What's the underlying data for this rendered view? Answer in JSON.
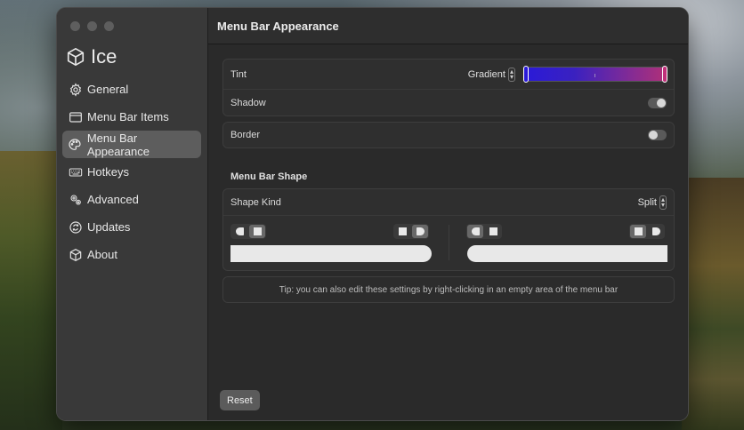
{
  "app": {
    "name": "Ice"
  },
  "sidebar": {
    "items": [
      {
        "label": "General",
        "icon": "gear-icon"
      },
      {
        "label": "Menu Bar Items",
        "icon": "menubar-icon"
      },
      {
        "label": "Menu Bar Appearance",
        "icon": "palette-icon",
        "active": true
      },
      {
        "label": "Hotkeys",
        "icon": "keyboard-icon"
      },
      {
        "label": "Advanced",
        "icon": "gears-icon"
      },
      {
        "label": "Updates",
        "icon": "refresh-icon"
      },
      {
        "label": "About",
        "icon": "box-icon"
      }
    ]
  },
  "main": {
    "title": "Menu Bar Appearance",
    "tint": {
      "label": "Tint",
      "value": "Gradient",
      "gradient_start": "#2a1ad8",
      "gradient_end": "#c0307a"
    },
    "shadow": {
      "label": "Shadow",
      "enabled": true
    },
    "border": {
      "label": "Border",
      "enabled": false
    },
    "shape_section_title": "Menu Bar Shape",
    "shape_kind": {
      "label": "Shape Kind",
      "value": "Split"
    },
    "tip": "Tip: you can also edit these settings by right-clicking in an empty area of the menu bar",
    "reset_label": "Reset"
  }
}
